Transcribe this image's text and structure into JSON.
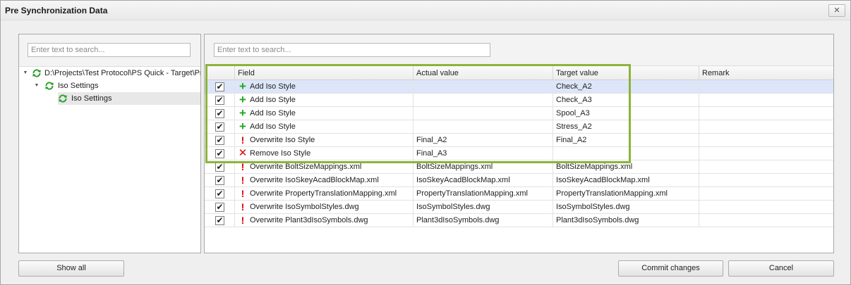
{
  "window": {
    "title": "Pre Synchronization Data",
    "close_label": "✕"
  },
  "left": {
    "search_placeholder": "Enter text to search...",
    "tree": [
      {
        "label": "D:\\Projects\\Test Protocol\\PS Quick - Target\\Pr",
        "expander": "▼"
      },
      {
        "label": "Iso Settings",
        "expander": "▼"
      },
      {
        "label": "Iso Settings"
      }
    ],
    "icon": "sync-icon"
  },
  "right": {
    "search_placeholder": "Enter text to search...",
    "columns": [
      "Field",
      "Actual value",
      "Target value",
      "Remark"
    ],
    "rows": [
      {
        "checked": "✔",
        "type": "add",
        "icon": "+",
        "field": "Add Iso Style",
        "actual": "",
        "target": "Check_A2",
        "remark": ""
      },
      {
        "checked": "✔",
        "type": "add",
        "icon": "+",
        "field": "Add Iso Style",
        "actual": "",
        "target": "Check_A3",
        "remark": ""
      },
      {
        "checked": "✔",
        "type": "add",
        "icon": "+",
        "field": "Add Iso Style",
        "actual": "",
        "target": "Spool_A3",
        "remark": ""
      },
      {
        "checked": "✔",
        "type": "add",
        "icon": "+",
        "field": "Add Iso Style",
        "actual": "",
        "target": "Stress_A2",
        "remark": ""
      },
      {
        "checked": "✔",
        "type": "overwrite",
        "icon": "!",
        "field": "Overwrite Iso Style",
        "actual": "Final_A2",
        "target": "Final_A2",
        "remark": ""
      },
      {
        "checked": "✔",
        "type": "remove",
        "icon": "✕",
        "field": "Remove Iso Style",
        "actual": "Final_A3",
        "target": "",
        "remark": ""
      },
      {
        "checked": "✔",
        "type": "overwrite",
        "icon": "!",
        "field": "Overwrite BoltSizeMappings.xml",
        "actual": "BoltSizeMappings.xml",
        "target": "BoltSizeMappings.xml",
        "remark": ""
      },
      {
        "checked": "✔",
        "type": "overwrite",
        "icon": "!",
        "field": "Overwrite IsoSkeyAcadBlockMap.xml",
        "actual": "IsoSkeyAcadBlockMap.xml",
        "target": "IsoSkeyAcadBlockMap.xml",
        "remark": ""
      },
      {
        "checked": "✔",
        "type": "overwrite",
        "icon": "!",
        "field": "Overwrite PropertyTranslationMapping.xml",
        "actual": "PropertyTranslationMapping.xml",
        "target": "PropertyTranslationMapping.xml",
        "remark": ""
      },
      {
        "checked": "✔",
        "type": "overwrite",
        "icon": "!",
        "field": "Overwrite IsoSymbolStyles.dwg",
        "actual": "IsoSymbolStyles.dwg",
        "target": "IsoSymbolStyles.dwg",
        "remark": ""
      },
      {
        "checked": "✔",
        "type": "overwrite",
        "icon": "!",
        "field": "Overwrite Plant3dIsoSymbols.dwg",
        "actual": "Plant3dIsoSymbols.dwg",
        "target": "Plant3dIsoSymbols.dwg",
        "remark": ""
      }
    ]
  },
  "buttons": {
    "show_all": "Show all",
    "commit": "Commit changes",
    "cancel": "Cancel"
  },
  "colors": {
    "highlight": "#8db33a",
    "add": "#1fa81f",
    "error": "#e00000",
    "selected_row": "#dde6f8"
  }
}
